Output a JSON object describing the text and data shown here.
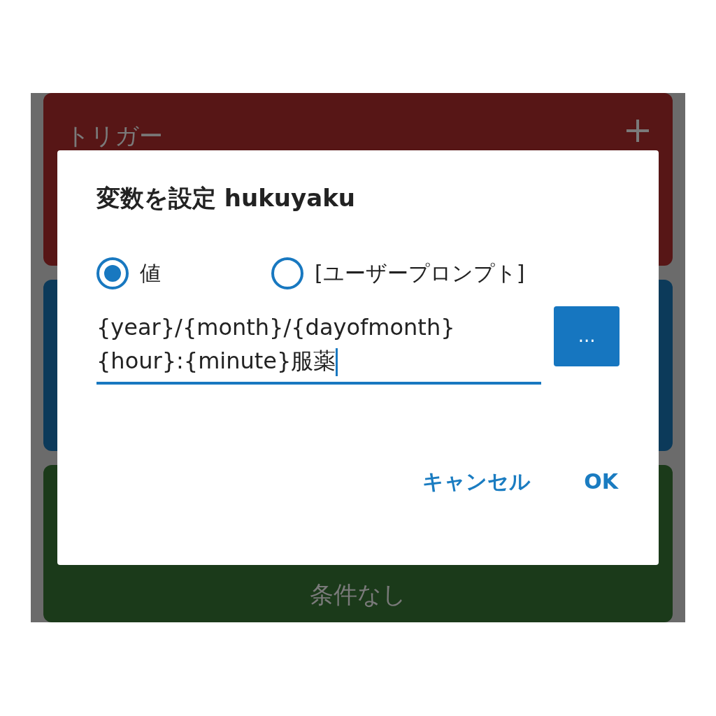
{
  "background_cards": [
    {
      "kind": "trigger",
      "title": "トリガー"
    },
    {
      "kind": "action"
    },
    {
      "kind": "constraint",
      "title": "条件なし"
    }
  ],
  "dialog": {
    "title": "変数を設定 hukuyaku",
    "options": [
      {
        "label": "値",
        "selected": true
      },
      {
        "label": "[ユーザープロンプト]",
        "selected": false
      }
    ],
    "field": {
      "value": "{year}/{month}/{dayofmonth} {hour}:{minute}服薬"
    },
    "more_button": "...",
    "buttons": [
      "キャンセル",
      "OK"
    ]
  }
}
